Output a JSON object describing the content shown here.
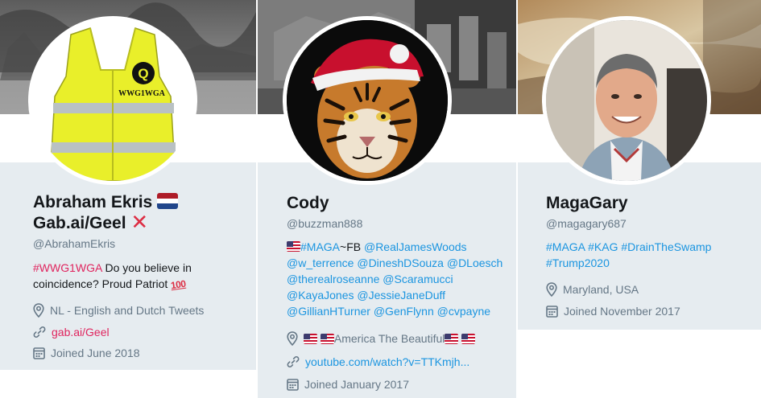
{
  "cards": [
    {
      "name_line1": "Abraham Ekris",
      "name_line2": "Gab.ai/Geel",
      "handle": "@AbrahamEkris",
      "bio_tag": "#WWG1WGA",
      "bio_text_1": " Do you believe in",
      "bio_text_2": "coincidence? Proud Patriot ",
      "avatar_vest_text": "WWG1WGA",
      "avatar_vest_letter": "Q",
      "location": "NL - English and Dutch Tweets",
      "website": "gab.ai/Geel",
      "joined": "Joined June 2018"
    },
    {
      "name": "Cody",
      "handle": "@buzzman888",
      "bio_maga": "#MAGA",
      "bio_fb": "~FB ",
      "bio_mentions": [
        "@RealJamesWoods",
        "@w_terrence",
        "@DineshDSouza",
        "@DLoesch",
        "@therealroseanne",
        "@Scaramucci",
        "@KayaJones",
        "@JessieJaneDuff",
        "@GillianHTurner",
        "@GenFlynn",
        "@cvpayne"
      ],
      "location": "America The Beautiful",
      "website": "youtube.com/watch?v=TTKmjh...",
      "joined": "Joined January 2017"
    },
    {
      "name": "MagaGary",
      "handle": "@magagary687",
      "bio_tags": [
        "#MAGA",
        "#KAG",
        "#DrainTheSwamp",
        "#Trump2020"
      ],
      "location": "Maryland, USA",
      "joined": "Joined November 2017"
    }
  ],
  "icons": [
    "location-pin-icon",
    "link-icon",
    "calendar-icon",
    "netherlands-flag-icon",
    "us-flag-icon",
    "red-x-icon",
    "hundred-points-icon"
  ],
  "colors": {
    "link": "#1b95e0",
    "hashtag_red": "#e0245e",
    "card_bg": "#e6ecf0",
    "muted_text": "#657786"
  }
}
